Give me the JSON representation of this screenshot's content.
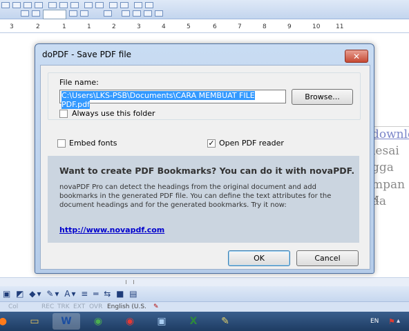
{
  "ruler": {
    "numbers": [
      "3",
      "2",
      "1",
      "1",
      "2",
      "3",
      "4",
      "5",
      "6",
      "7",
      "8",
      "9",
      "10",
      "11"
    ]
  },
  "document": {
    "lines": [
      "downlo",
      "lesai",
      "gga",
      "mpan k",
      "da"
    ]
  },
  "status_bar": {
    "col": "Col",
    "rec": "REC",
    "trk": "TRK",
    "ext": "EXT",
    "ovr": "OVR",
    "language": "English (U.S."
  },
  "tray": {
    "language": "EN"
  },
  "dialog": {
    "title": "doPDF - Save PDF file",
    "close_symbol": "✕",
    "file_name_label": "File name:",
    "file_name_value": "C:\\Users\\LKS-PSB\\Documents\\CARA MEMBUAT FILE PDF.pdf",
    "browse_label": "Browse...",
    "always_use_folder_label": "Always use this folder",
    "always_use_folder_checked": false,
    "embed_fonts_label": "Embed fonts",
    "embed_fonts_checked": false,
    "open_reader_label": "Open PDF reader",
    "open_reader_checked": true,
    "promo": {
      "heading": "Want to create PDF Bookmarks? You can do it with novaPDF.",
      "body": "novaPDF Pro can detect the headings from the original document and add bookmarks in the generated PDF file. You can define the text attributes for the document headings and for the generated bookmarks. Try it now:",
      "link": "http://www.novapdf.com"
    },
    "ok_label": "OK",
    "cancel_label": "Cancel"
  },
  "colors": {
    "selection": "#3399ff",
    "close_button": "#c64a34",
    "link": "#0000cc",
    "promo_bg": "#cbd5e0"
  }
}
